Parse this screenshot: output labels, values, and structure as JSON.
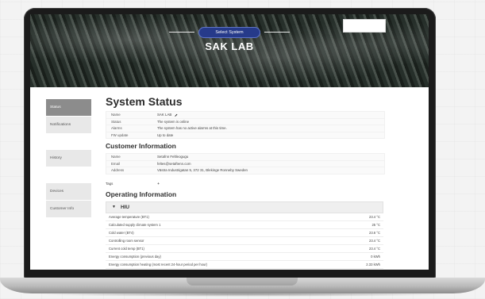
{
  "header": {
    "select_system": "Select System",
    "title": "SAK LAB"
  },
  "sidebar": {
    "items": [
      {
        "label": "Status",
        "active": true
      },
      {
        "label": "Notifications",
        "active": false
      },
      {
        "label": "History",
        "active": false
      },
      {
        "label": "Devices",
        "active": false
      },
      {
        "label": "Customer Info",
        "active": false
      }
    ]
  },
  "system_status": {
    "title": "System Status",
    "rows": [
      {
        "k": "Name",
        "v": "SAK LAB"
      },
      {
        "k": "Status",
        "v": "The system is online"
      },
      {
        "k": "Alarms",
        "v": "The system has no active alarms at this time."
      },
      {
        "k": "FW update",
        "v": "Up to date"
      }
    ]
  },
  "customer": {
    "title": "Customer Information",
    "rows": [
      {
        "k": "Name",
        "v": "Setafnn Feltleogugu"
      },
      {
        "k": "Email",
        "v": "feltes@setaftenn.com"
      },
      {
        "k": "Address",
        "v": "Västra Industrigatan 5, 372 31, Blekinge Ronneby Sweden"
      }
    ],
    "tags_label": "Tags",
    "tags_add": "+"
  },
  "operating": {
    "title": "Operating Information",
    "section": "HIU",
    "rows": [
      {
        "label": "Average temperature (BT1)",
        "value": "23.4 °C"
      },
      {
        "label": "Calculated supply climate system 1",
        "value": "25 °C"
      },
      {
        "label": "Cold water (BT4)",
        "value": "23.6 °C"
      },
      {
        "label": "Controlling room sensor",
        "value": "23.4 °C"
      },
      {
        "label": "Current cold temp (BT1)",
        "value": "23.4 °C"
      },
      {
        "label": "Energy consumption (previous day)",
        "value": "0 kWh"
      },
      {
        "label": "Energy consumption heating (most recent 24-hour period per hour)",
        "value": "2.33 kWh"
      }
    ]
  },
  "colors": {
    "accent": "#263a8a"
  }
}
